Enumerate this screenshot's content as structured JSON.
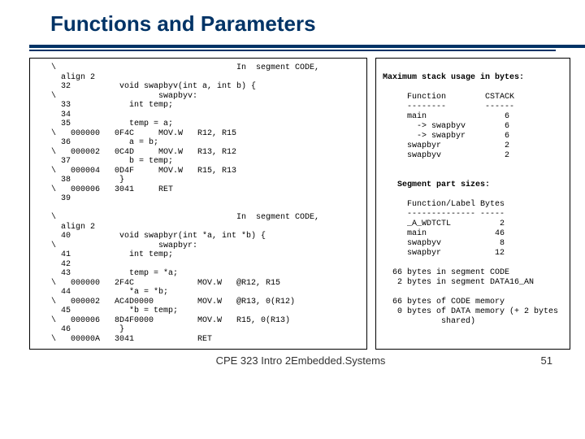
{
  "title": "Functions and Parameters",
  "code_block": "   \\                                     In  segment CODE, \n     align 2\n     32          void swapbyv(int a, int b) {\n   \\                     swapbyv:\n     33            int temp;\n     34          \n     35            temp = a;\n   \\   000000   0F4C     MOV.W   R12, R15\n     36            a = b;\n   \\   000002   0C4D     MOV.W   R13, R12\n     37            b = temp;\n   \\   000004   0D4F     MOV.W   R15, R13\n     38          }\n   \\   000006   3041     RET\n     39          \n\n   \\                                     In  segment CODE, \n     align 2\n     40          void swapbyr(int *a, int *b) {\n   \\                     swapbyr:\n     41            int temp;\n     42          \n     43            temp = *a;\n   \\   000000   2F4C             MOV.W   @R12, R15\n     44            *a = *b;\n   \\   000002   AC4D0000         MOV.W   @R13, 0(R12)\n     45            *b = temp;\n   \\   000006   8D4F0000         MOV.W   R15, 0(R13)\n     46          }\n   \\   00000A   3041             RET",
  "stats": {
    "heading": "Maximum stack usage in bytes:",
    "table1": "     Function        CSTACK\n     --------        ------\n     main                6\n       -> swapbyv        6\n       -> swapbyr        6\n     swapbyr             2\n     swapbyv             2",
    "seg_heading": "   Segment part sizes:",
    "table2": "     Function/Label Bytes\n     -------------- -----\n     _A_WDTCTL          2\n     main              46\n     swapbyv            8\n     swapbyr           12",
    "summary1": "  66 bytes in segment CODE\n   2 bytes in segment DATA16_AN",
    "summary2": "  66 bytes of CODE memory\n   0 bytes of DATA memory (+ 2 bytes\n            shared)"
  },
  "footer": {
    "center": "CPE 323 Intro 2Embedded.Systems",
    "page": "51"
  }
}
